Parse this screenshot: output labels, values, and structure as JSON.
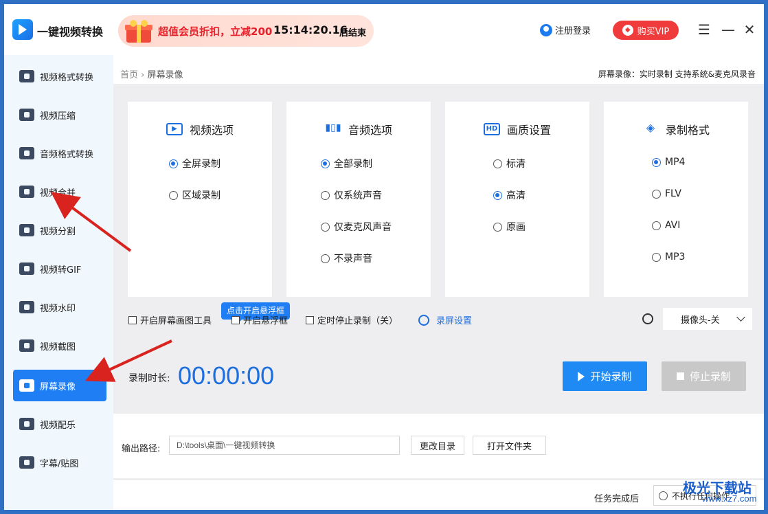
{
  "app": {
    "title": "一键视频转换",
    "promo_text": "超值会员折扣，立减200",
    "promo_time": "15:14:20.16",
    "promo_end": "后结束",
    "login_label": "注册登录",
    "vip_label": "购买VIP"
  },
  "sidebar": {
    "items": [
      {
        "label": "视频格式转换",
        "icon": "video-convert-icon"
      },
      {
        "label": "视频压缩",
        "icon": "compress-icon"
      },
      {
        "label": "音频格式转换",
        "icon": "audio-convert-icon"
      },
      {
        "label": "视频合并",
        "icon": "merge-icon"
      },
      {
        "label": "视频分割",
        "icon": "split-icon"
      },
      {
        "label": "视频转GIF",
        "icon": "gif-icon"
      },
      {
        "label": "视频水印",
        "icon": "watermark-icon"
      },
      {
        "label": "视频截图",
        "icon": "screenshot-icon"
      },
      {
        "label": "屏幕录像",
        "icon": "screen-record-icon",
        "active": true
      },
      {
        "label": "视频配乐",
        "icon": "music-icon"
      },
      {
        "label": "字幕/贴图",
        "icon": "subtitle-icon"
      }
    ]
  },
  "breadcrumb": {
    "home": "首页",
    "separator": "›",
    "current": "屏幕录像",
    "right_text": "屏幕录像：实时录制 支持系统&麦克风录音"
  },
  "cards": {
    "video": {
      "title": "视频选项",
      "options": [
        {
          "label": "全屏录制",
          "checked": true
        },
        {
          "label": "区域录制",
          "checked": false
        }
      ]
    },
    "audio": {
      "title": "音频选项",
      "options": [
        {
          "label": "全部录制",
          "checked": true
        },
        {
          "label": "仅系统声音",
          "checked": false
        },
        {
          "label": "仅麦克风声音",
          "checked": false
        },
        {
          "label": "不录声音",
          "checked": false
        }
      ]
    },
    "quality": {
      "title": "画质设置",
      "badge": "HD",
      "options": [
        {
          "label": "标清",
          "checked": false
        },
        {
          "label": "高清",
          "checked": true
        },
        {
          "label": "原画",
          "checked": false
        }
      ]
    },
    "format": {
      "title": "录制格式",
      "options": [
        {
          "label": "MP4",
          "checked": true
        },
        {
          "label": "FLV",
          "checked": false
        },
        {
          "label": "AVI",
          "checked": false
        },
        {
          "label": "MP3",
          "checked": false
        }
      ]
    }
  },
  "checks": {
    "draw_tool": "开启屏幕画图工具",
    "float": "开启悬浮框",
    "float_tooltip": "点击开启悬浮框",
    "timed_stop": "定时停止录制（关）",
    "settings": "录屏设置",
    "camera": "摄像头-关"
  },
  "record": {
    "duration_label": "录制时长:",
    "duration": "00:00:00",
    "start": "开始录制",
    "stop": "停止录制"
  },
  "output": {
    "label": "输出路径:",
    "path": "D:\\tools\\桌面\\一键视频转换",
    "change_dir": "更改目录",
    "open_folder": "打开文件夹"
  },
  "footer": {
    "after_label": "任务完成后",
    "after_value": "不执行任何操作"
  },
  "watermark": {
    "text": "极光下载站",
    "url": "www.xz7.com"
  },
  "colors": {
    "accent": "#1f7ef3",
    "annotation_arrow": "#d9231f"
  }
}
